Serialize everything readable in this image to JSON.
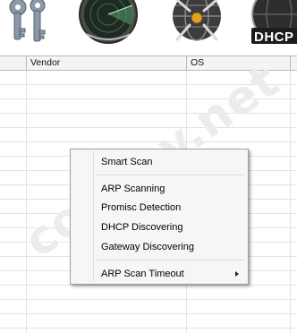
{
  "toolbar": {
    "icons": [
      "keys-icon",
      "radar-icon",
      "globe-target-icon",
      "dhcp-icon"
    ],
    "dhcp_label": "DHCP"
  },
  "columns": [
    "",
    "Vendor",
    "OS",
    ""
  ],
  "watermark": "codeby.net",
  "context_menu": {
    "items": [
      "Smart Scan",
      "ARP Scanning",
      "Promisc Detection",
      "DHCP Discovering",
      "Gateway Discovering",
      "ARP Scan Timeout"
    ]
  }
}
